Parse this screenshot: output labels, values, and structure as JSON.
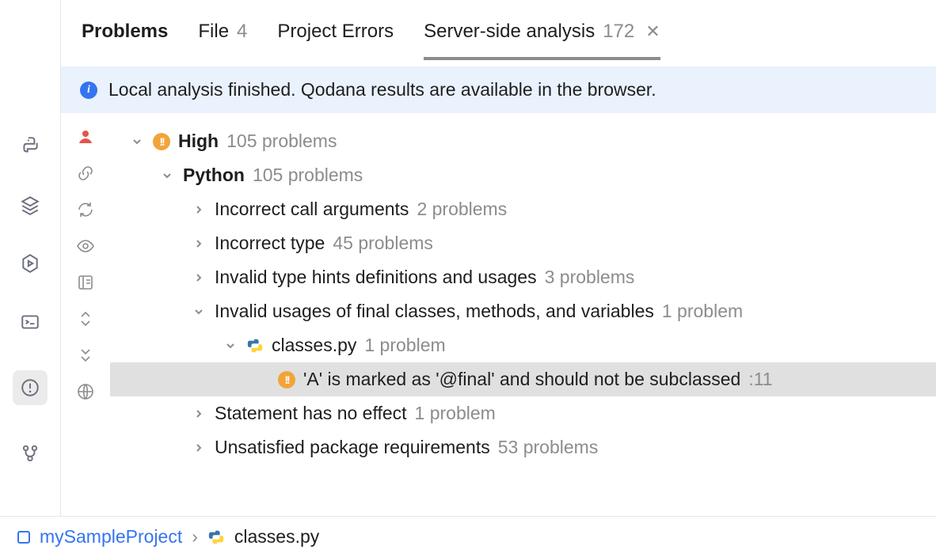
{
  "tabs": {
    "problems": "Problems",
    "file": {
      "label": "File",
      "count": "4"
    },
    "project_errors": "Project Errors",
    "server": {
      "label": "Server-side analysis",
      "count": "172"
    }
  },
  "banner": "Local analysis finished. Qodana results are available in the browser.",
  "tree": {
    "high": {
      "label": "High",
      "count": "105 problems"
    },
    "python": {
      "label": "Python",
      "count": "105 problems"
    },
    "items": [
      {
        "label": "Incorrect call arguments",
        "count": "2 problems"
      },
      {
        "label": "Incorrect type",
        "count": "45 problems"
      },
      {
        "label": "Invalid type hints definitions and usages",
        "count": "3 problems"
      },
      {
        "label": "Invalid usages of final classes, methods, and variables",
        "count": "1 problem"
      }
    ],
    "file": {
      "name": "classes.py",
      "count": "1 problem"
    },
    "issue": {
      "text": "'A' is marked as '@final' and should not be subclassed",
      "line": ":11"
    },
    "after": [
      {
        "label": "Statement has no effect",
        "count": "1 problem"
      },
      {
        "label": "Unsatisfied package requirements",
        "count": "53 problems"
      }
    ]
  },
  "breadcrumb": {
    "project": "mySampleProject",
    "file": "classes.py"
  }
}
